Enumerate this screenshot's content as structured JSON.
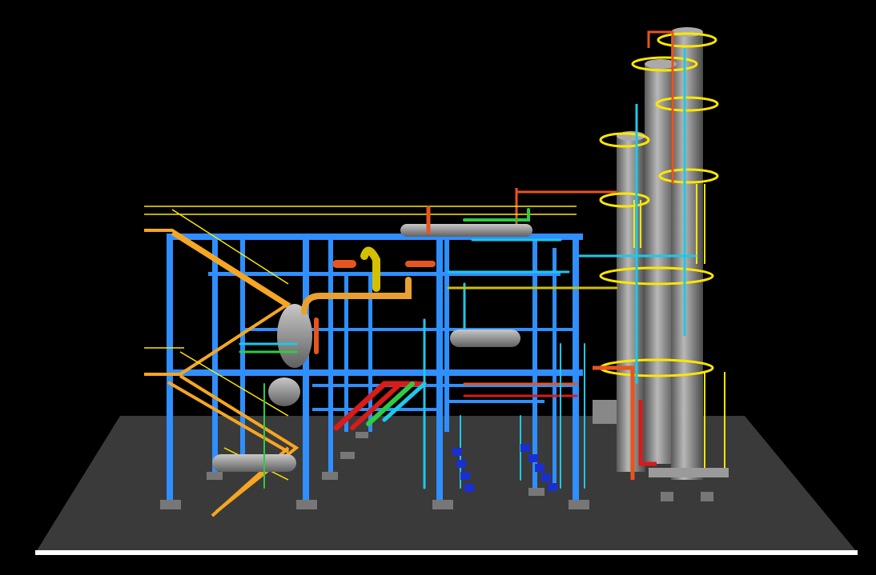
{
  "scene": {
    "background": "#000000",
    "colors": {
      "floor": "#3a3a3a",
      "floor_edge": "#ffffff",
      "steel": "#2f8fff",
      "steel_dark": "#1f6fd0",
      "stair": "#f5a623",
      "handrail": "#ffe600",
      "column": "#8c8c8c",
      "pipe_orange": "#e8541e",
      "pipe_cyan": "#1ec8e8",
      "pipe_green": "#2ecc40",
      "pipe_red": "#d81b1b",
      "pipe_yellow": "#d4c000",
      "pump": "#1a2fd0",
      "vessel": "#9a9a9a",
      "footing": "#777777"
    }
  }
}
